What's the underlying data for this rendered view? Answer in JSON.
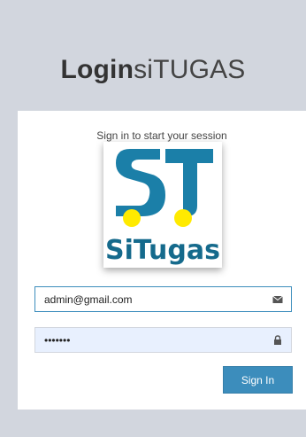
{
  "header": {
    "title_bold": "Login",
    "title_light": "siTUGAS"
  },
  "login_box": {
    "message": "Sign in to start your session"
  },
  "brand": {
    "name": "SiTugas",
    "mark": "ST",
    "colors": {
      "teal": "#1b7fa8",
      "dark_teal": "#156a8c",
      "yellow": "#ffea00"
    }
  },
  "form": {
    "email": {
      "value": "admin@gmail.com",
      "icon": "envelope-icon"
    },
    "password": {
      "value": "•••••••",
      "icon": "lock-icon"
    },
    "submit_label": "Sign In"
  },
  "colors": {
    "accent": "#3c8dbc",
    "background": "#d2d6de"
  }
}
